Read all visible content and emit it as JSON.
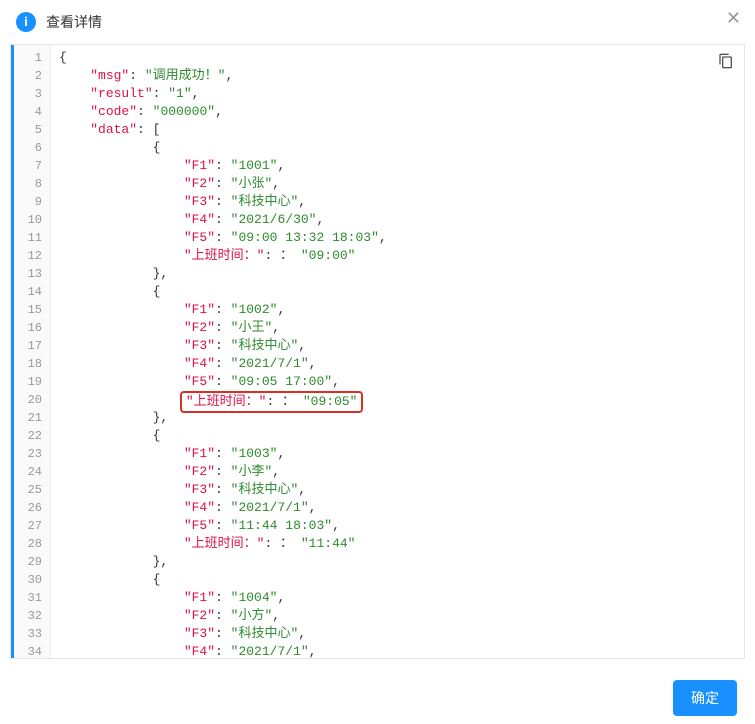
{
  "header": {
    "title": "查看详情"
  },
  "buttons": {
    "confirm": "确定"
  },
  "code": {
    "lines": [
      {
        "indent": 0,
        "type": "open",
        "text": "{"
      },
      {
        "indent": 1,
        "type": "kv",
        "key": "msg",
        "value": "调用成功！",
        "trailing": ","
      },
      {
        "indent": 1,
        "type": "kv",
        "key": "result",
        "value": "1",
        "trailing": ","
      },
      {
        "indent": 1,
        "type": "kv",
        "key": "code",
        "value": "000000",
        "trailing": ","
      },
      {
        "indent": 1,
        "type": "karr",
        "key": "data",
        "trailing": "["
      },
      {
        "indent": 3,
        "type": "open",
        "text": "{"
      },
      {
        "indent": 4,
        "type": "kv",
        "key": "F1",
        "value": "1001",
        "trailing": ","
      },
      {
        "indent": 4,
        "type": "kv",
        "key": "F2",
        "value": "小张",
        "trailing": ","
      },
      {
        "indent": 4,
        "type": "kv",
        "key": "F3",
        "value": "科技中心",
        "trailing": ","
      },
      {
        "indent": 4,
        "type": "kv",
        "key": "F4",
        "value": "2021/6/30",
        "trailing": ","
      },
      {
        "indent": 4,
        "type": "kv",
        "key": "F5",
        "value": "09:00 13:32 18:03",
        "trailing": ","
      },
      {
        "indent": 4,
        "type": "kv",
        "key": "上班时间：",
        "value": "：\"09:00\"",
        "valueRaw": true,
        "trailing": ""
      },
      {
        "indent": 3,
        "type": "close",
        "text": "},"
      },
      {
        "indent": 3,
        "type": "open",
        "text": "{"
      },
      {
        "indent": 4,
        "type": "kv",
        "key": "F1",
        "value": "1002",
        "trailing": ","
      },
      {
        "indent": 4,
        "type": "kv",
        "key": "F2",
        "value": "小王",
        "trailing": ","
      },
      {
        "indent": 4,
        "type": "kv",
        "key": "F3",
        "value": "科技中心",
        "trailing": ","
      },
      {
        "indent": 4,
        "type": "kv",
        "key": "F4",
        "value": "2021/7/1",
        "trailing": ","
      },
      {
        "indent": 4,
        "type": "kv",
        "key": "F5",
        "value": "09:05 17:00",
        "trailing": ","
      },
      {
        "indent": 4,
        "type": "kv",
        "key": "上班时间：",
        "value": "：\"09:05\"",
        "valueRaw": true,
        "trailing": "",
        "highlight": true
      },
      {
        "indent": 3,
        "type": "close",
        "text": "},"
      },
      {
        "indent": 3,
        "type": "open",
        "text": "{"
      },
      {
        "indent": 4,
        "type": "kv",
        "key": "F1",
        "value": "1003",
        "trailing": ","
      },
      {
        "indent": 4,
        "type": "kv",
        "key": "F2",
        "value": "小李",
        "trailing": ","
      },
      {
        "indent": 4,
        "type": "kv",
        "key": "F3",
        "value": "科技中心",
        "trailing": ","
      },
      {
        "indent": 4,
        "type": "kv",
        "key": "F4",
        "value": "2021/7/1",
        "trailing": ","
      },
      {
        "indent": 4,
        "type": "kv",
        "key": "F5",
        "value": "11:44 18:03",
        "trailing": ","
      },
      {
        "indent": 4,
        "type": "kv",
        "key": "上班时间：",
        "value": "：\"11:44\"",
        "valueRaw": true,
        "trailing": ""
      },
      {
        "indent": 3,
        "type": "close",
        "text": "},"
      },
      {
        "indent": 3,
        "type": "open",
        "text": "{"
      },
      {
        "indent": 4,
        "type": "kv",
        "key": "F1",
        "value": "1004",
        "trailing": ","
      },
      {
        "indent": 4,
        "type": "kv",
        "key": "F2",
        "value": "小方",
        "trailing": ","
      },
      {
        "indent": 4,
        "type": "kv",
        "key": "F3",
        "value": "科技中心",
        "trailing": ","
      },
      {
        "indent": 4,
        "type": "kv",
        "key": "F4",
        "value": "2021/7/1",
        "trailing": ","
      }
    ]
  }
}
